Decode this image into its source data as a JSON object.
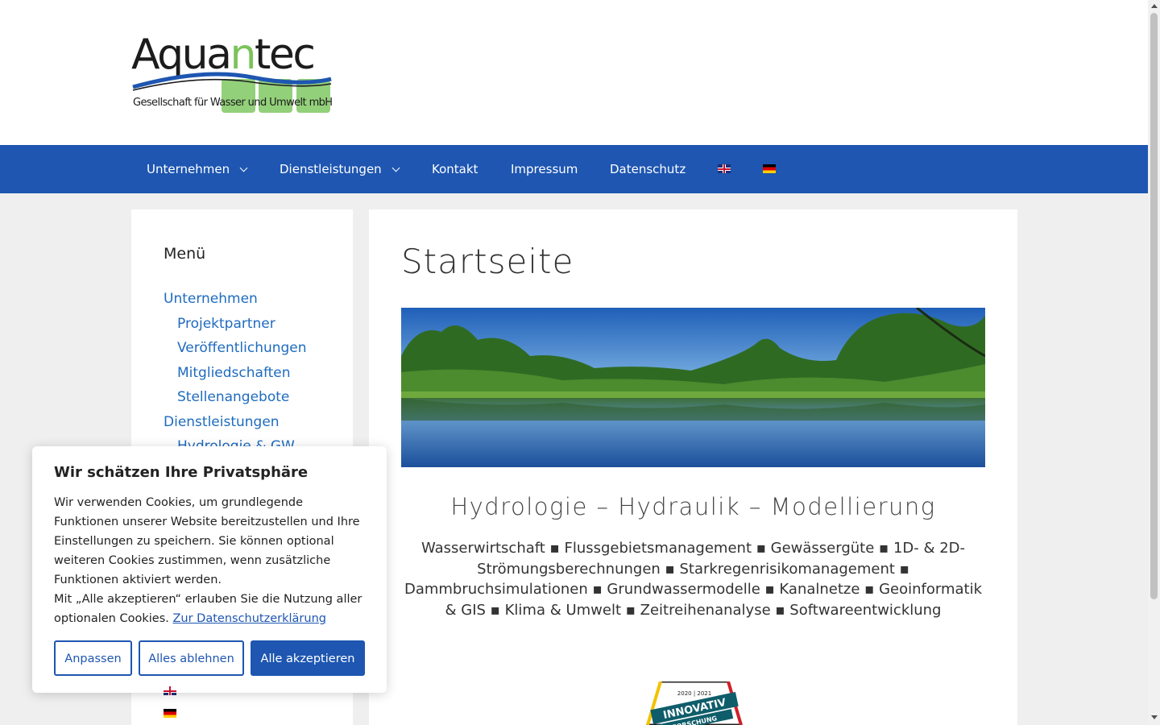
{
  "logo": {
    "word_a": "Aqua",
    "word_n": "n",
    "word_b": "tec",
    "subtitle": "Gesellschaft für Wasser und Umwelt mbH"
  },
  "nav": {
    "items": [
      "Unternehmen",
      "Dienstleistungen",
      "Kontakt",
      "Impressum",
      "Datenschutz"
    ],
    "lang_en_icon": "flag-uk-icon",
    "lang_de_icon": "flag-de-icon"
  },
  "sidebar": {
    "title": "Menü",
    "links": [
      "Unternehmen",
      "Projektpartner",
      "Veröffentlichungen",
      "Mitgliedschaften",
      "Stellenangebote",
      "Dienstleistungen",
      "Hydrologie & GW"
    ]
  },
  "main": {
    "title": "Startseite",
    "tagline": "Hydrologie – Hydraulik – Modellierung",
    "services": "Wasserwirtschaft ▪ Flussgebietsmanagement ▪ Gewässergüte ▪ 1D- & 2D-Strömungsberechnungen ▪ Starkregenrisikomanagement ▪ Dammbruchsimulationen ▪ Grundwassermodelle ▪ Kanalnetze ▪ Geoinformatik & GIS ▪ Klima & Umwelt ▪ Zeitreihenanalyse ▪ Softwareentwicklung",
    "badge_years": "2020 | 2021",
    "badge_label": "INNOVATIV",
    "badge_sub": "FORSCHUNG"
  },
  "cookie": {
    "title": "Wir schätzen Ihre Privatsphäre",
    "text": "Wir verwenden Cookies, um grundlegende Funktionen unserer Website bereitzustellen und Ihre Einstellungen zu speichern. Sie können optional weiteren Cookies zustimmen, wenn zusätzliche Funktionen aktiviert werden.",
    "text2": "Mit „Alle akzeptieren“ erlauben Sie die Nutzung aller optionalen Cookies.",
    "link": "Zur Datenschutzerklärung",
    "buttons": {
      "customize": "Anpassen",
      "reject": "Alles ablehnen",
      "accept": "Alle akzeptieren"
    }
  },
  "colors": {
    "brand_blue": "#1e56b1",
    "link_blue": "#1e6bbf",
    "logo_green": "#7cc35a"
  }
}
